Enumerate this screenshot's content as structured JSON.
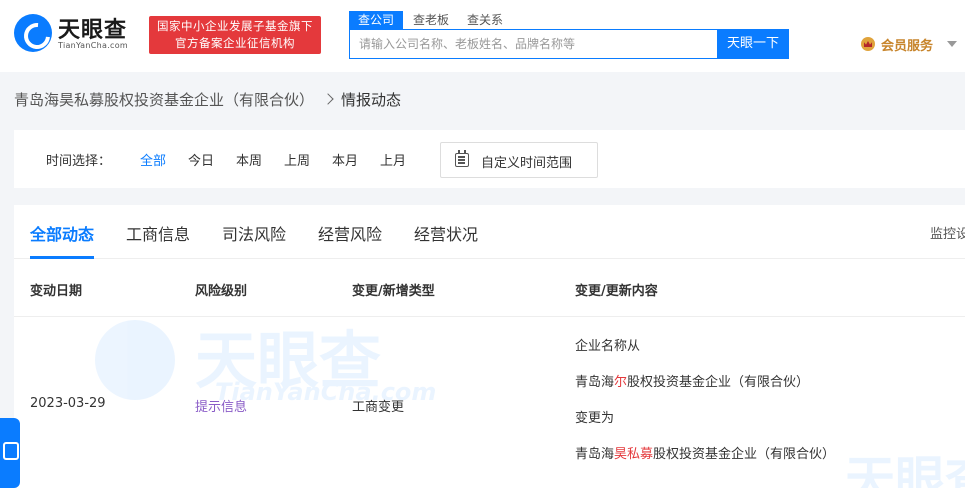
{
  "header": {
    "logo_cn": "天眼查",
    "logo_en": "TianYanCha.com",
    "gov_badge": [
      "国家中小企业发展子基金旗下",
      "官方备案企业征信机构"
    ],
    "search_tabs": [
      "查公司",
      "查老板",
      "查关系"
    ],
    "search_placeholder": "请输入公司名称、老板姓名、品牌名称等",
    "search_button": "天眼一下",
    "vip_label": "会员服务"
  },
  "breadcrumb": {
    "company": "青岛海昊私募股权投资基金企业（有限合伙）",
    "current": "情报动态"
  },
  "filter": {
    "label": "时间选择：",
    "options": [
      "全部",
      "今日",
      "本周",
      "上周",
      "本月",
      "上月"
    ],
    "active": "全部",
    "custom_label": "自定义时间范围"
  },
  "tabs": {
    "items": [
      "全部动态",
      "工商信息",
      "司法风险",
      "经营风险",
      "经营状况"
    ],
    "active": "全部动态",
    "monitor": "监控设"
  },
  "table": {
    "headers": [
      "变动日期",
      "风险级别",
      "变更/新增类型",
      "变更/更新内容"
    ],
    "rows": [
      {
        "date": "2023-03-29",
        "risk": "提示信息",
        "type": "工商变更",
        "content": {
          "line1": "企业名称从",
          "old_prefix": "青岛海",
          "old_highlight": "尔",
          "old_suffix": "股权投资基金企业（有限合伙）",
          "line3": "变更为",
          "new_prefix": "青岛海",
          "new_highlight": "昊私募",
          "new_suffix": "股权投资基金企业（有限合伙）"
        }
      }
    ]
  },
  "watermark": {
    "cn": "天眼查",
    "en": "TianYanCha.com"
  },
  "colors": {
    "brand_blue": "#0a7cff",
    "highlight_red": "#e4393c",
    "risk_purple": "#8a5cc7",
    "vip_gold": "#c7842b"
  }
}
